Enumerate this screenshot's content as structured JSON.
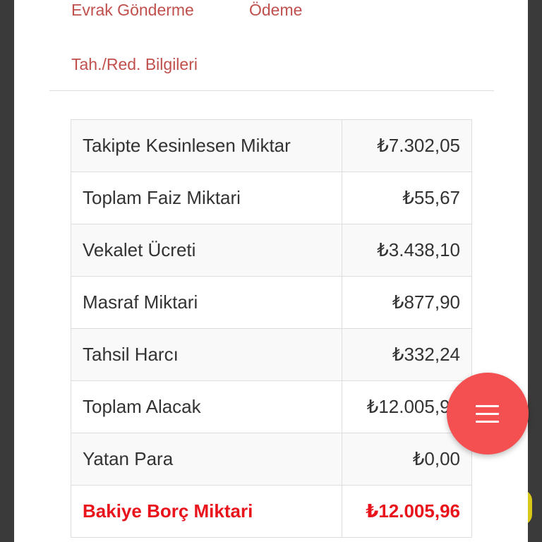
{
  "tabs": {
    "evrak_gonderme": "Evrak Gönderme",
    "odeme": "Ödeme",
    "tah_red_bilgileri": "Tah./Red. Bilgileri"
  },
  "summary": {
    "rows": [
      {
        "label": "Takipte Kesinlesen Miktar",
        "value": "₺7.302,05"
      },
      {
        "label": "Toplam Faiz Miktari",
        "value": "₺55,67"
      },
      {
        "label": "Vekalet Ücreti",
        "value": "₺3.438,10"
      },
      {
        "label": "Masraf Miktari",
        "value": "₺877,90"
      },
      {
        "label": "Tahsil Harcı",
        "value": "₺332,24"
      },
      {
        "label": "Toplam Alacak",
        "value": "₺12.005,96"
      },
      {
        "label": "Yatan Para",
        "value": "₺0,00"
      },
      {
        "label": "Bakiye Borç Miktari",
        "value": "₺12.005,96"
      }
    ]
  },
  "fab": {
    "icon": "menu-icon"
  },
  "colors": {
    "tab_link": "#c0504d",
    "total_row": "#e8131b",
    "fab": "#f45051"
  }
}
